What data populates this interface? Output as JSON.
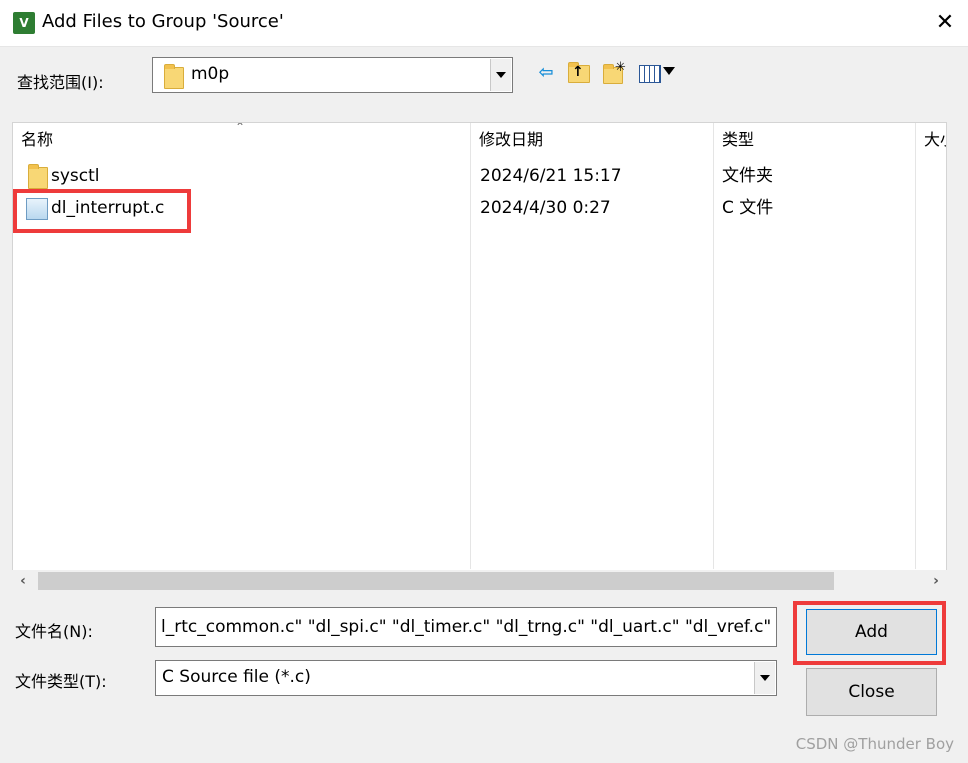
{
  "window": {
    "title": "Add Files to Group 'Source'",
    "app_icon_text": "V",
    "close_glyph": "✕"
  },
  "toolbar": {
    "look_in_label": "查找范围(I):",
    "look_in_value": "m0p",
    "icons": [
      "back-arrow-icon",
      "up-folder-icon",
      "new-folder-icon",
      "view-menu-icon"
    ]
  },
  "list": {
    "columns": [
      "名称",
      "修改日期",
      "类型",
      "大小"
    ],
    "rows": [
      {
        "name": "sysctl",
        "date": "2024/6/21 15:17",
        "type": "文件夹",
        "icon": "folder-icon"
      },
      {
        "name": "dl_interrupt.c",
        "date": "2024/4/30 0:27",
        "type": "C 文件",
        "icon": "c-file-icon"
      }
    ]
  },
  "form": {
    "filename_label": "文件名(N):",
    "filename_value": "l_rtc_common.c\" \"dl_spi.c\" \"dl_timer.c\" \"dl_trng.c\" \"dl_uart.c\" \"dl_vref.c\"",
    "filetype_label": "文件类型(T):",
    "filetype_value": "C Source file (*.c)"
  },
  "buttons": {
    "add": "Add",
    "close": "Close"
  },
  "highlight_color": "#ee3b3b",
  "watermark": "CSDN @Thunder Boy"
}
